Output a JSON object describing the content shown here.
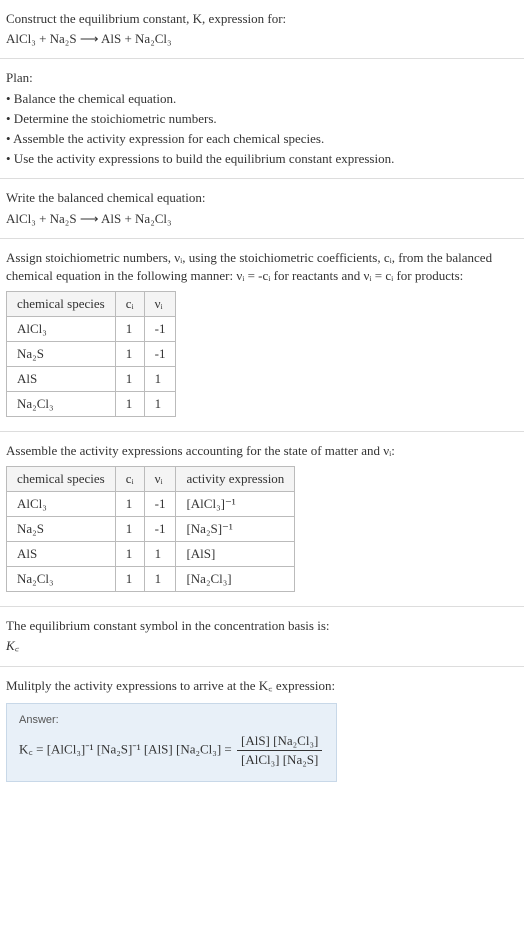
{
  "header": {
    "prompt": "Construct the equilibrium constant, K, expression for:",
    "equation": "AlCl₃ + Na₂S ⟶ AlS + Na₂Cl₃"
  },
  "plan": {
    "title": "Plan:",
    "items": [
      "• Balance the chemical equation.",
      "• Determine the stoichiometric numbers.",
      "• Assemble the activity expression for each chemical species.",
      "• Use the activity expressions to build the equilibrium constant expression."
    ]
  },
  "balanced": {
    "intro": "Write the balanced chemical equation:",
    "equation": "AlCl₃ + Na₂S ⟶ AlS + Na₂Cl₃"
  },
  "stoich_intro_1": "Assign stoichiometric numbers, νᵢ, using the stoichiometric coefficients, cᵢ, from the balanced chemical equation in the following manner: νᵢ = -cᵢ for reactants and νᵢ = cᵢ for products:",
  "table1": {
    "headers": [
      "chemical species",
      "cᵢ",
      "νᵢ"
    ],
    "rows": [
      [
        "AlCl₃",
        "1",
        "-1"
      ],
      [
        "Na₂S",
        "1",
        "-1"
      ],
      [
        "AlS",
        "1",
        "1"
      ],
      [
        "Na₂Cl₃",
        "1",
        "1"
      ]
    ]
  },
  "activity_intro": "Assemble the activity expressions accounting for the state of matter and νᵢ:",
  "table2": {
    "headers": [
      "chemical species",
      "cᵢ",
      "νᵢ",
      "activity expression"
    ],
    "rows": [
      [
        "AlCl₃",
        "1",
        "-1",
        "[AlCl₃]⁻¹"
      ],
      [
        "Na₂S",
        "1",
        "-1",
        "[Na₂S]⁻¹"
      ],
      [
        "AlS",
        "1",
        "1",
        "[AlS]"
      ],
      [
        "Na₂Cl₃",
        "1",
        "1",
        "[Na₂Cl₃]"
      ]
    ]
  },
  "symbol_intro": "The equilibrium constant symbol in the concentration basis is:",
  "symbol": "K꜀",
  "multiply_intro": "Mulitply the activity expressions to arrive at the K꜀ expression:",
  "answer": {
    "label": "Answer:",
    "lhs": "K꜀ = [AlCl₃]⁻¹ [Na₂S]⁻¹ [AlS] [Na₂Cl₃] = ",
    "frac_num": "[AlS] [Na₂Cl₃]",
    "frac_den": "[AlCl₃] [Na₂S]"
  },
  "chart_data": {
    "type": "table",
    "tables": [
      {
        "headers": [
          "chemical species",
          "c_i",
          "v_i"
        ],
        "rows": [
          {
            "species": "AlCl3",
            "c_i": 1,
            "v_i": -1
          },
          {
            "species": "Na2S",
            "c_i": 1,
            "v_i": -1
          },
          {
            "species": "AlS",
            "c_i": 1,
            "v_i": 1
          },
          {
            "species": "Na2Cl3",
            "c_i": 1,
            "v_i": 1
          }
        ]
      },
      {
        "headers": [
          "chemical species",
          "c_i",
          "v_i",
          "activity expression"
        ],
        "rows": [
          {
            "species": "AlCl3",
            "c_i": 1,
            "v_i": -1,
            "activity": "[AlCl3]^-1"
          },
          {
            "species": "Na2S",
            "c_i": 1,
            "v_i": -1,
            "activity": "[Na2S]^-1"
          },
          {
            "species": "AlS",
            "c_i": 1,
            "v_i": 1,
            "activity": "[AlS]"
          },
          {
            "species": "Na2Cl3",
            "c_i": 1,
            "v_i": 1,
            "activity": "[Na2Cl3]"
          }
        ]
      }
    ],
    "equilibrium_expression": "Kc = [AlS][Na2Cl3] / ([AlCl3][Na2S])"
  }
}
